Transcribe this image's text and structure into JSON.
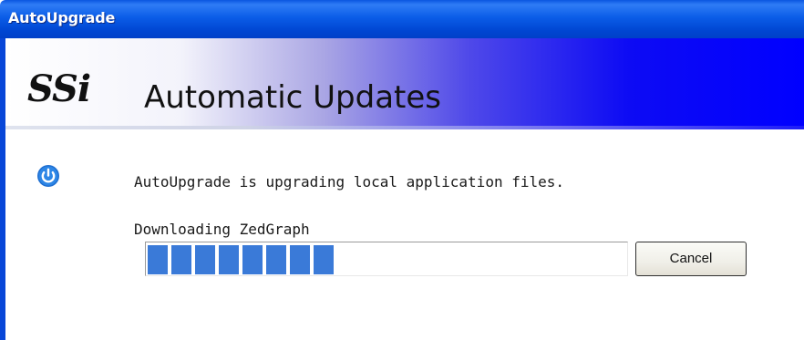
{
  "window": {
    "title": "AutoUpgrade"
  },
  "banner": {
    "logo": "SSi",
    "title": "Automatic Updates"
  },
  "main": {
    "message": "AutoUpgrade is upgrading local application files.",
    "status": "Downloading ZedGraph",
    "progress_fraction": 0.41,
    "cancel_label": "Cancel"
  },
  "icons": {
    "status_icon": "power-icon"
  },
  "colors": {
    "titlebar": "#0b5de8",
    "banner_end": "#0000ff",
    "progress": "#3a7ad8"
  }
}
